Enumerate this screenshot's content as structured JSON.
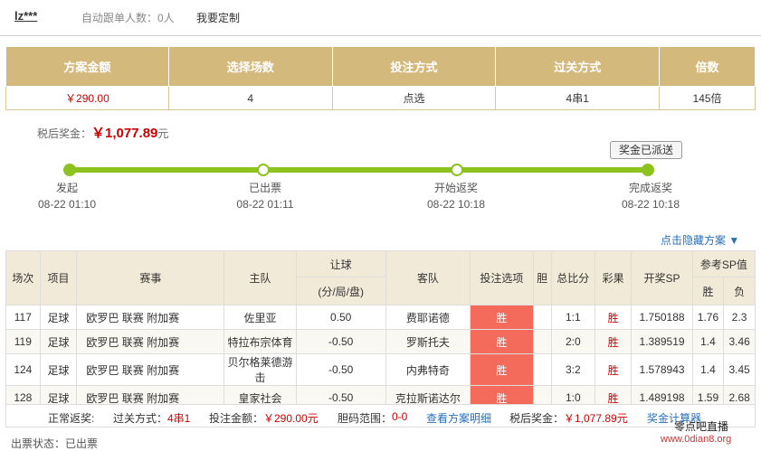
{
  "header": {
    "user": "lz***",
    "follow_count": "自动跟单人数：0人",
    "customize": "我要定制"
  },
  "summary": {
    "headers": [
      "方案金额",
      "选择场数",
      "投注方式",
      "过关方式",
      "倍数"
    ],
    "values": [
      "￥290.00",
      "4",
      "点选",
      "4串1",
      "145倍"
    ]
  },
  "bonus": {
    "label": "税后奖金：",
    "amount": "￥1,077.89",
    "unit": "元",
    "status_badge": "奖金已派送"
  },
  "steps": [
    {
      "label": "发起",
      "time": "08-22 01:10"
    },
    {
      "label": "已出票",
      "time": "08-22 01:11"
    },
    {
      "label": "开始返奖",
      "time": "08-22 10:18"
    },
    {
      "label": "完成返奖",
      "time": "08-22 10:18"
    }
  ],
  "hidden_plan": "点击隐藏方案 ▼",
  "detail": {
    "headers": {
      "no": "场次",
      "type": "项目",
      "league": "赛事",
      "home": "主队",
      "handicap": "让球",
      "handicap_sub": "(分/局/盘)",
      "away": "客队",
      "pick": "投注选项",
      "banker": "胆",
      "score": "总比分",
      "result": "彩果",
      "sp": "开奖SP",
      "ref_sp": "参考SP值",
      "win": "胜",
      "lose": "负"
    },
    "rows": [
      {
        "no": "117",
        "type": "足球",
        "league": "欧罗巴 联赛 附加赛",
        "home": "佐里亚",
        "handicap": "0.50",
        "away": "费耶诺德",
        "pick": "胜",
        "banker": "",
        "score": "1:1",
        "result": "胜",
        "sp": "1.750188",
        "win": "1.76",
        "lose": "2.3"
      },
      {
        "no": "119",
        "type": "足球",
        "league": "欧罗巴 联赛 附加赛",
        "home": "特拉布宗体育",
        "handicap": "-0.50",
        "away": "罗斯托夫",
        "pick": "胜",
        "banker": "",
        "score": "2:0",
        "result": "胜",
        "sp": "1.389519",
        "win": "1.4",
        "lose": "3.46"
      },
      {
        "no": "124",
        "type": "足球",
        "league": "欧罗巴 联赛 附加赛",
        "home": "贝尔格莱德游击",
        "handicap": "-0.50",
        "away": "内弗特奇",
        "pick": "胜",
        "banker": "",
        "score": "3:2",
        "result": "胜",
        "sp": "1.578943",
        "win": "1.4",
        "lose": "3.45"
      },
      {
        "no": "128",
        "type": "足球",
        "league": "欧罗巴 联赛 附加赛",
        "home": "皇家社会",
        "handicap": "-0.50",
        "away": "克拉斯诺达尔",
        "pick": "胜",
        "banker": "",
        "score": "1:0",
        "result": "胜",
        "sp": "1.489198",
        "win": "1.59",
        "lose": "2.68"
      }
    ]
  },
  "footer": {
    "normal_label": "正常返奖:",
    "pass_label": "过关方式：",
    "pass_value": "4串1",
    "bet_label": "投注金额：",
    "bet_value": "￥290.00元",
    "banker_label": "胆码范围：",
    "banker_value": "0-0",
    "view_detail": "查看方案明细",
    "tax_label": "税后奖金：",
    "tax_value": "￥1,077.89元",
    "calculator": "奖金计算器"
  },
  "ticket_status": "出票状态：已出票",
  "watermark": {
    "line1": "零点吧直播",
    "line2": "www.0dian8.org"
  }
}
